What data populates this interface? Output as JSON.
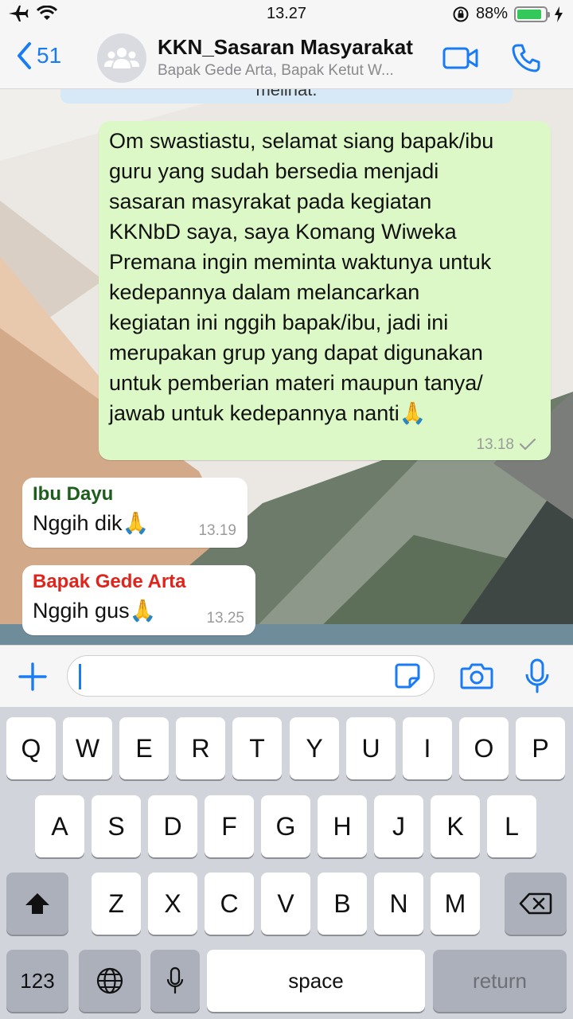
{
  "status_bar": {
    "time": "13.27",
    "battery_percent": "88%",
    "battery_level": 0.88
  },
  "header": {
    "back_count": "51",
    "title": "KKN_Sasaran Masyarakat",
    "subtitle": "Bapak Gede Arta, Bapak Ketut W..."
  },
  "chat": {
    "top_partial_text": "melihat.",
    "messages": [
      {
        "direction": "outgoing",
        "lines": [
          "Om swastiastu, selamat siang bapak/ibu",
          "guru yang sudah bersedia menjadi",
          "sasaran masyrakat pada kegiatan",
          "KKNbD saya, saya Komang Wiweka",
          "Premana ingin meminta waktunya untuk",
          "kedepannya dalam melancarkan",
          "kegiatan ini nggih bapak/ibu, jadi ini",
          "merupakan grup yang dapat digunakan",
          "untuk pemberian materi maupun tanya/",
          "jawab untuk kedepannya nanti🙏"
        ],
        "time": "13.18",
        "status_icon": "single-check-icon"
      },
      {
        "direction": "incoming",
        "sender": "Ibu Dayu",
        "sender_color": "#1d5e1d",
        "text": "Nggih dik🙏",
        "time": "13.19"
      },
      {
        "direction": "incoming",
        "sender": "Bapak Gede Arta",
        "sender_color": "#e0241b",
        "text": "Nggih gus🙏",
        "time": "13.25"
      }
    ]
  },
  "input_bar": {
    "value": "",
    "icons": [
      "plus-icon",
      "sticker-icon",
      "camera-icon",
      "microphone-icon"
    ]
  },
  "keyboard": {
    "row1": [
      "Q",
      "W",
      "E",
      "R",
      "T",
      "Y",
      "U",
      "I",
      "O",
      "P"
    ],
    "row2": [
      "A",
      "S",
      "D",
      "F",
      "G",
      "H",
      "J",
      "K",
      "L"
    ],
    "row3": [
      "Z",
      "X",
      "C",
      "V",
      "B",
      "N",
      "M"
    ],
    "numbers_label": "123",
    "space_label": "space",
    "return_label": "return"
  },
  "colors": {
    "accent": "#1a7cf5",
    "outgoing_bubble": "#dcf8c6",
    "incoming_bubble": "#ffffff"
  }
}
